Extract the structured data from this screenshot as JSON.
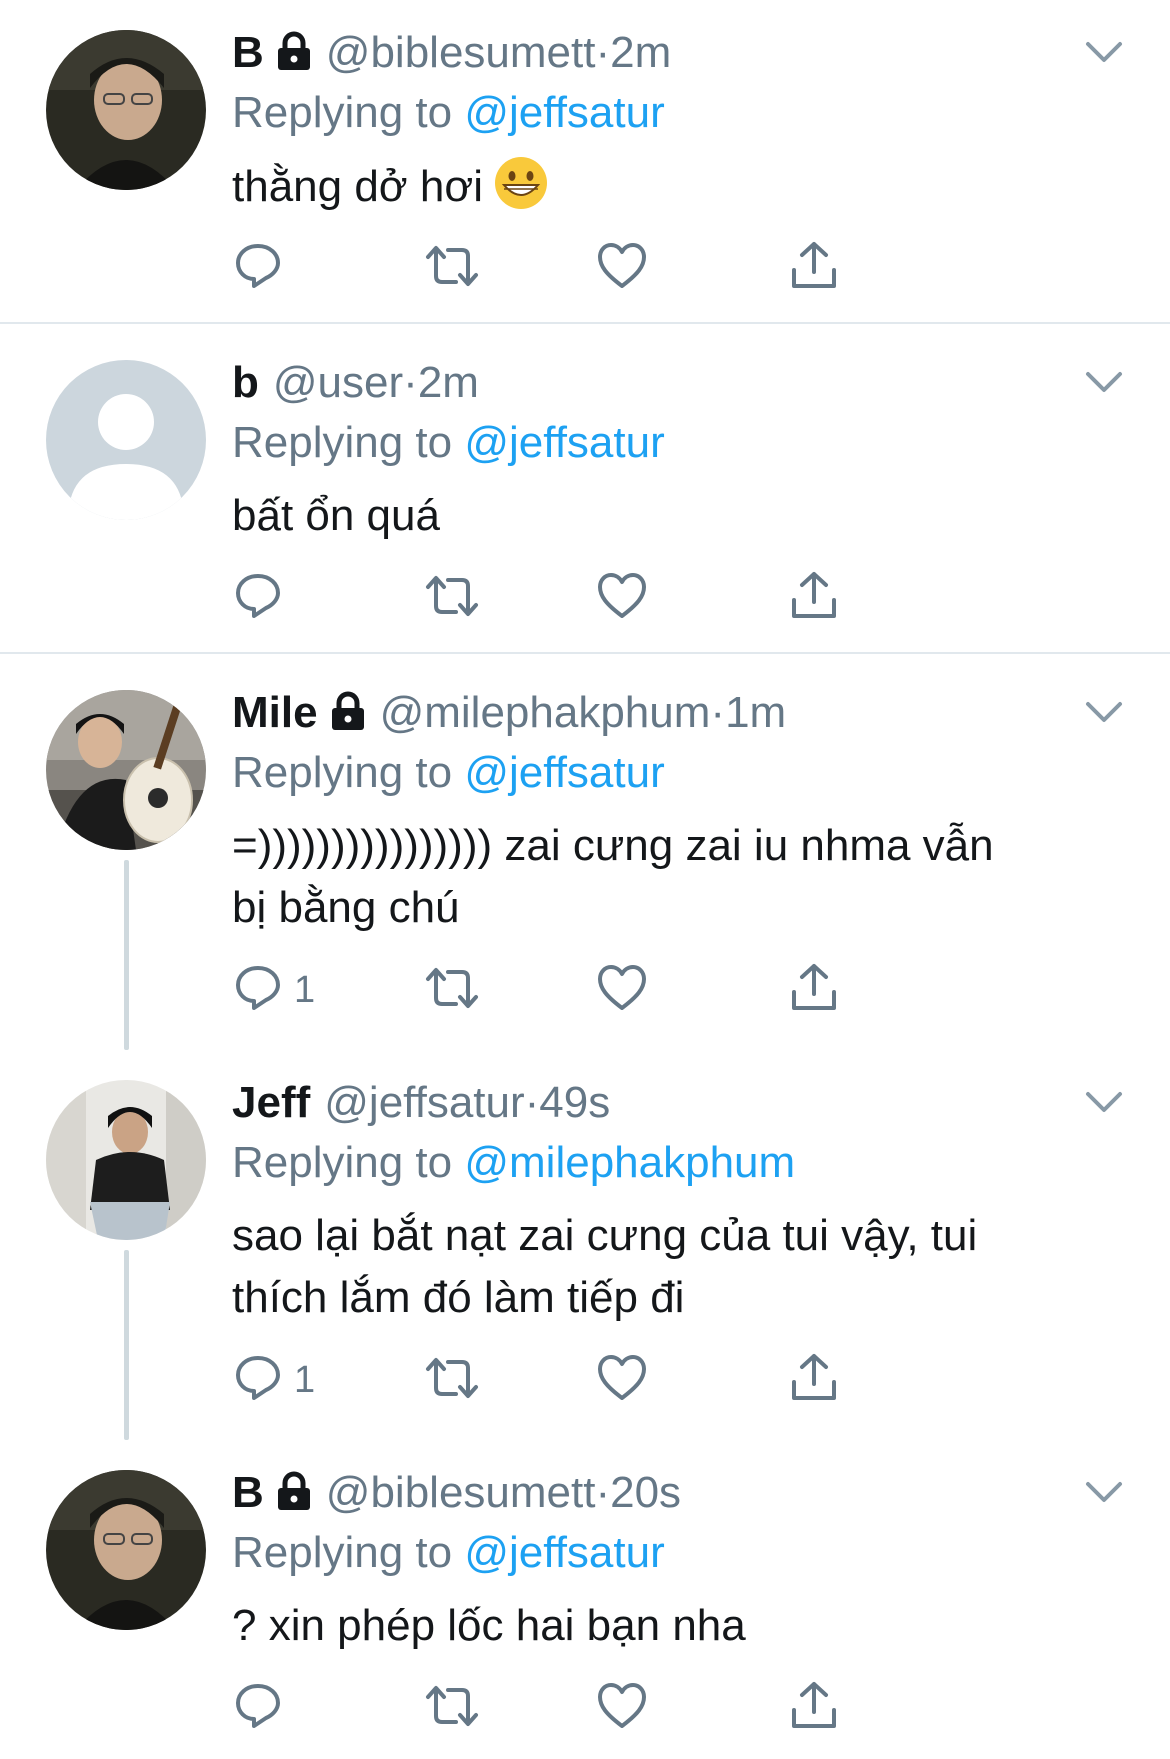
{
  "tweets": [
    {
      "name": "B",
      "locked": true,
      "handle": "@biblesumett",
      "dot": "·",
      "time": "2m",
      "replying_prefix": "Replying to ",
      "replying_to": "@jeffsatur",
      "text": "thằng dở hơi",
      "emoji": "grinning-face",
      "reply_count": "",
      "avatar": "photo"
    },
    {
      "name": "b",
      "locked": false,
      "handle": "@user",
      "dot": "·",
      "time": "2m",
      "replying_prefix": "Replying to ",
      "replying_to": "@jeffsatur",
      "text": "bất ổn quá",
      "reply_count": "",
      "avatar": "default-silhouette"
    },
    {
      "name": "Mile",
      "locked": true,
      "handle": "@milephakphum",
      "dot": "·",
      "time": "1m",
      "replying_prefix": "Replying to ",
      "replying_to": "@jeffsatur",
      "text_line1": "=)))))))))))))))) zai cưng zai iu nhma vẫn",
      "text_line2": "bị bằng chú",
      "reply_count": "1",
      "avatar": "photo"
    },
    {
      "name": "Jeff",
      "locked": false,
      "handle": "@jeffsatur",
      "dot": "·",
      "time": "49s",
      "replying_prefix": "Replying to ",
      "replying_to": "@milephakphum",
      "text_line1": "sao lại bắt nạt zai cưng của tui vậy, tui",
      "text_line2": "thích lắm đó làm tiếp đi",
      "reply_count": "1",
      "avatar": "photo"
    },
    {
      "name": "B",
      "locked": true,
      "handle": "@biblesumett",
      "dot": "·",
      "time": "20s",
      "replying_prefix": "Replying to ",
      "replying_to": "@jeffsatur",
      "text": "? xin phép lốc hai bạn nha",
      "reply_count": "",
      "avatar": "photo"
    }
  ],
  "icons": {
    "reply": "reply-icon",
    "retweet": "retweet-icon",
    "like": "heart-icon",
    "share": "share-icon",
    "more": "chevron-down-icon",
    "lock": "lock-icon"
  },
  "colors": {
    "link": "#1da1f2",
    "muted": "#657786",
    "text": "#14171a",
    "divider": "#e1e8ed",
    "thread": "#cfd9de"
  }
}
